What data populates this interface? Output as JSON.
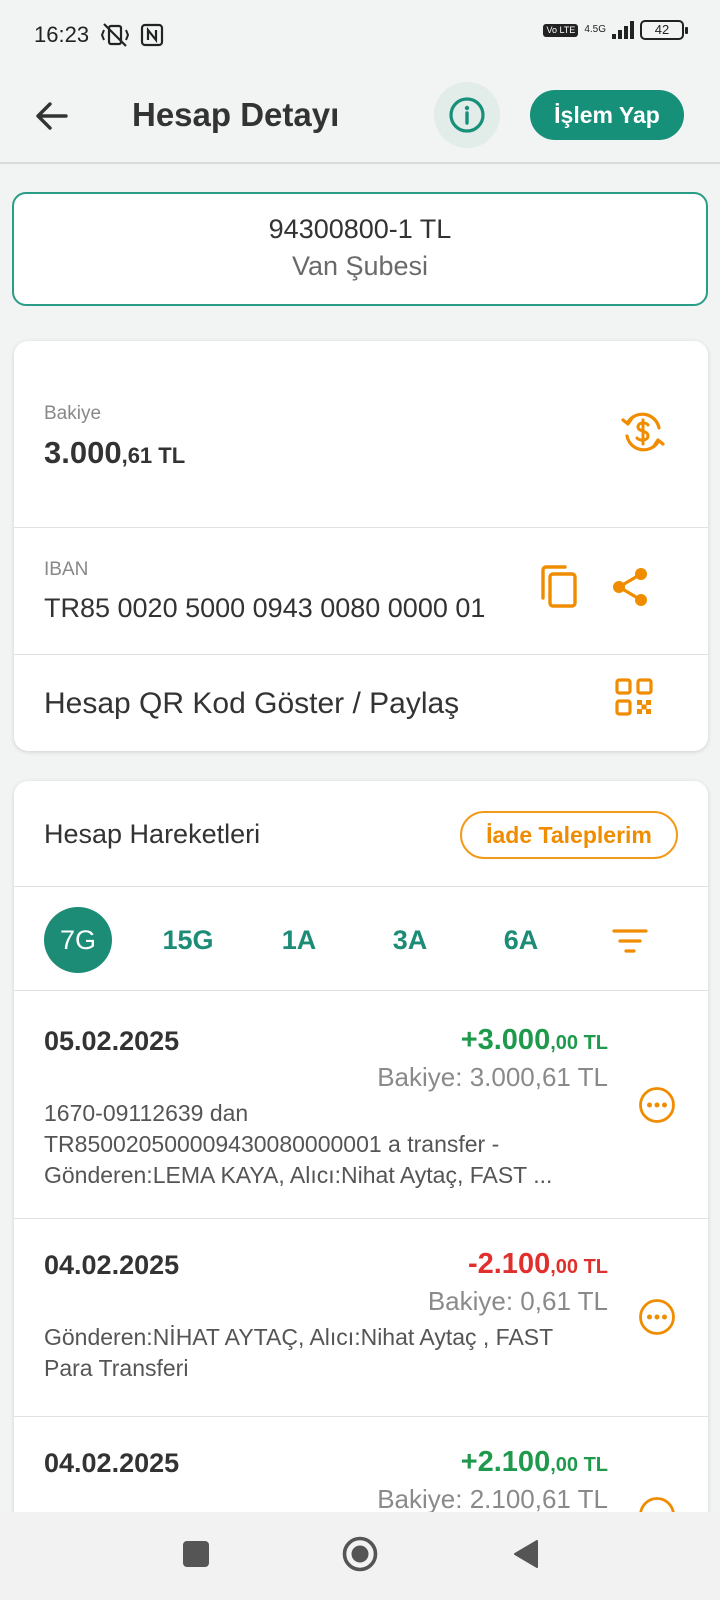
{
  "status_bar": {
    "time": "16:23",
    "network_badge": "Vo LTE",
    "network_type": "4.5G",
    "battery": "42"
  },
  "header": {
    "title": "Hesap Detayı",
    "action_label": "İşlem Yap",
    "accent": "#17907a"
  },
  "account": {
    "number": "94300800-1 TL",
    "branch": "Van Şubesi"
  },
  "balance": {
    "label": "Bakiye",
    "main": "3.000",
    "fraction": ",61 TL"
  },
  "iban": {
    "label": "IBAN",
    "value": "TR85 0020 5000 0943 0080 0000 01"
  },
  "qr": {
    "label": "Hesap QR Kod Göster / Paylaş"
  },
  "transactions": {
    "title": "Hesap Hareketleri",
    "refund_label": "İade Taleplerim",
    "periods": [
      "7G",
      "15G",
      "1A",
      "3A",
      "6A"
    ],
    "selected_period": "7G",
    "items": [
      {
        "date": "05.02.2025",
        "amount_main": "+3.000",
        "amount_frac": ",00 TL",
        "balance": "Bakiye: 3.000,61 TL",
        "desc": [
          "1670-09112639 dan",
          "TR850020500009430080000001 a transfer -",
          "Gönderen:LEMA KAYA, Alıcı:Nihat Aytaç, FAST ..."
        ]
      },
      {
        "date": "04.02.2025",
        "amount_main": "-2.100",
        "amount_frac": ",00 TL",
        "balance": "Bakiye: 0,61 TL",
        "desc": [
          "Gönderen:NİHAT AYTAÇ, Alıcı:Nihat Aytaç , FAST",
          "Para Transferi"
        ]
      },
      {
        "date": "04.02.2025",
        "amount_main": "+2.100",
        "amount_frac": ",00 TL",
        "balance": "Bakiye: 2.100,61 TL",
        "desc": []
      }
    ]
  },
  "colors": {
    "primary": "#1c8c77",
    "orange": "#f08c00",
    "positive": "#1f9a4c",
    "negative": "#e0302d"
  }
}
